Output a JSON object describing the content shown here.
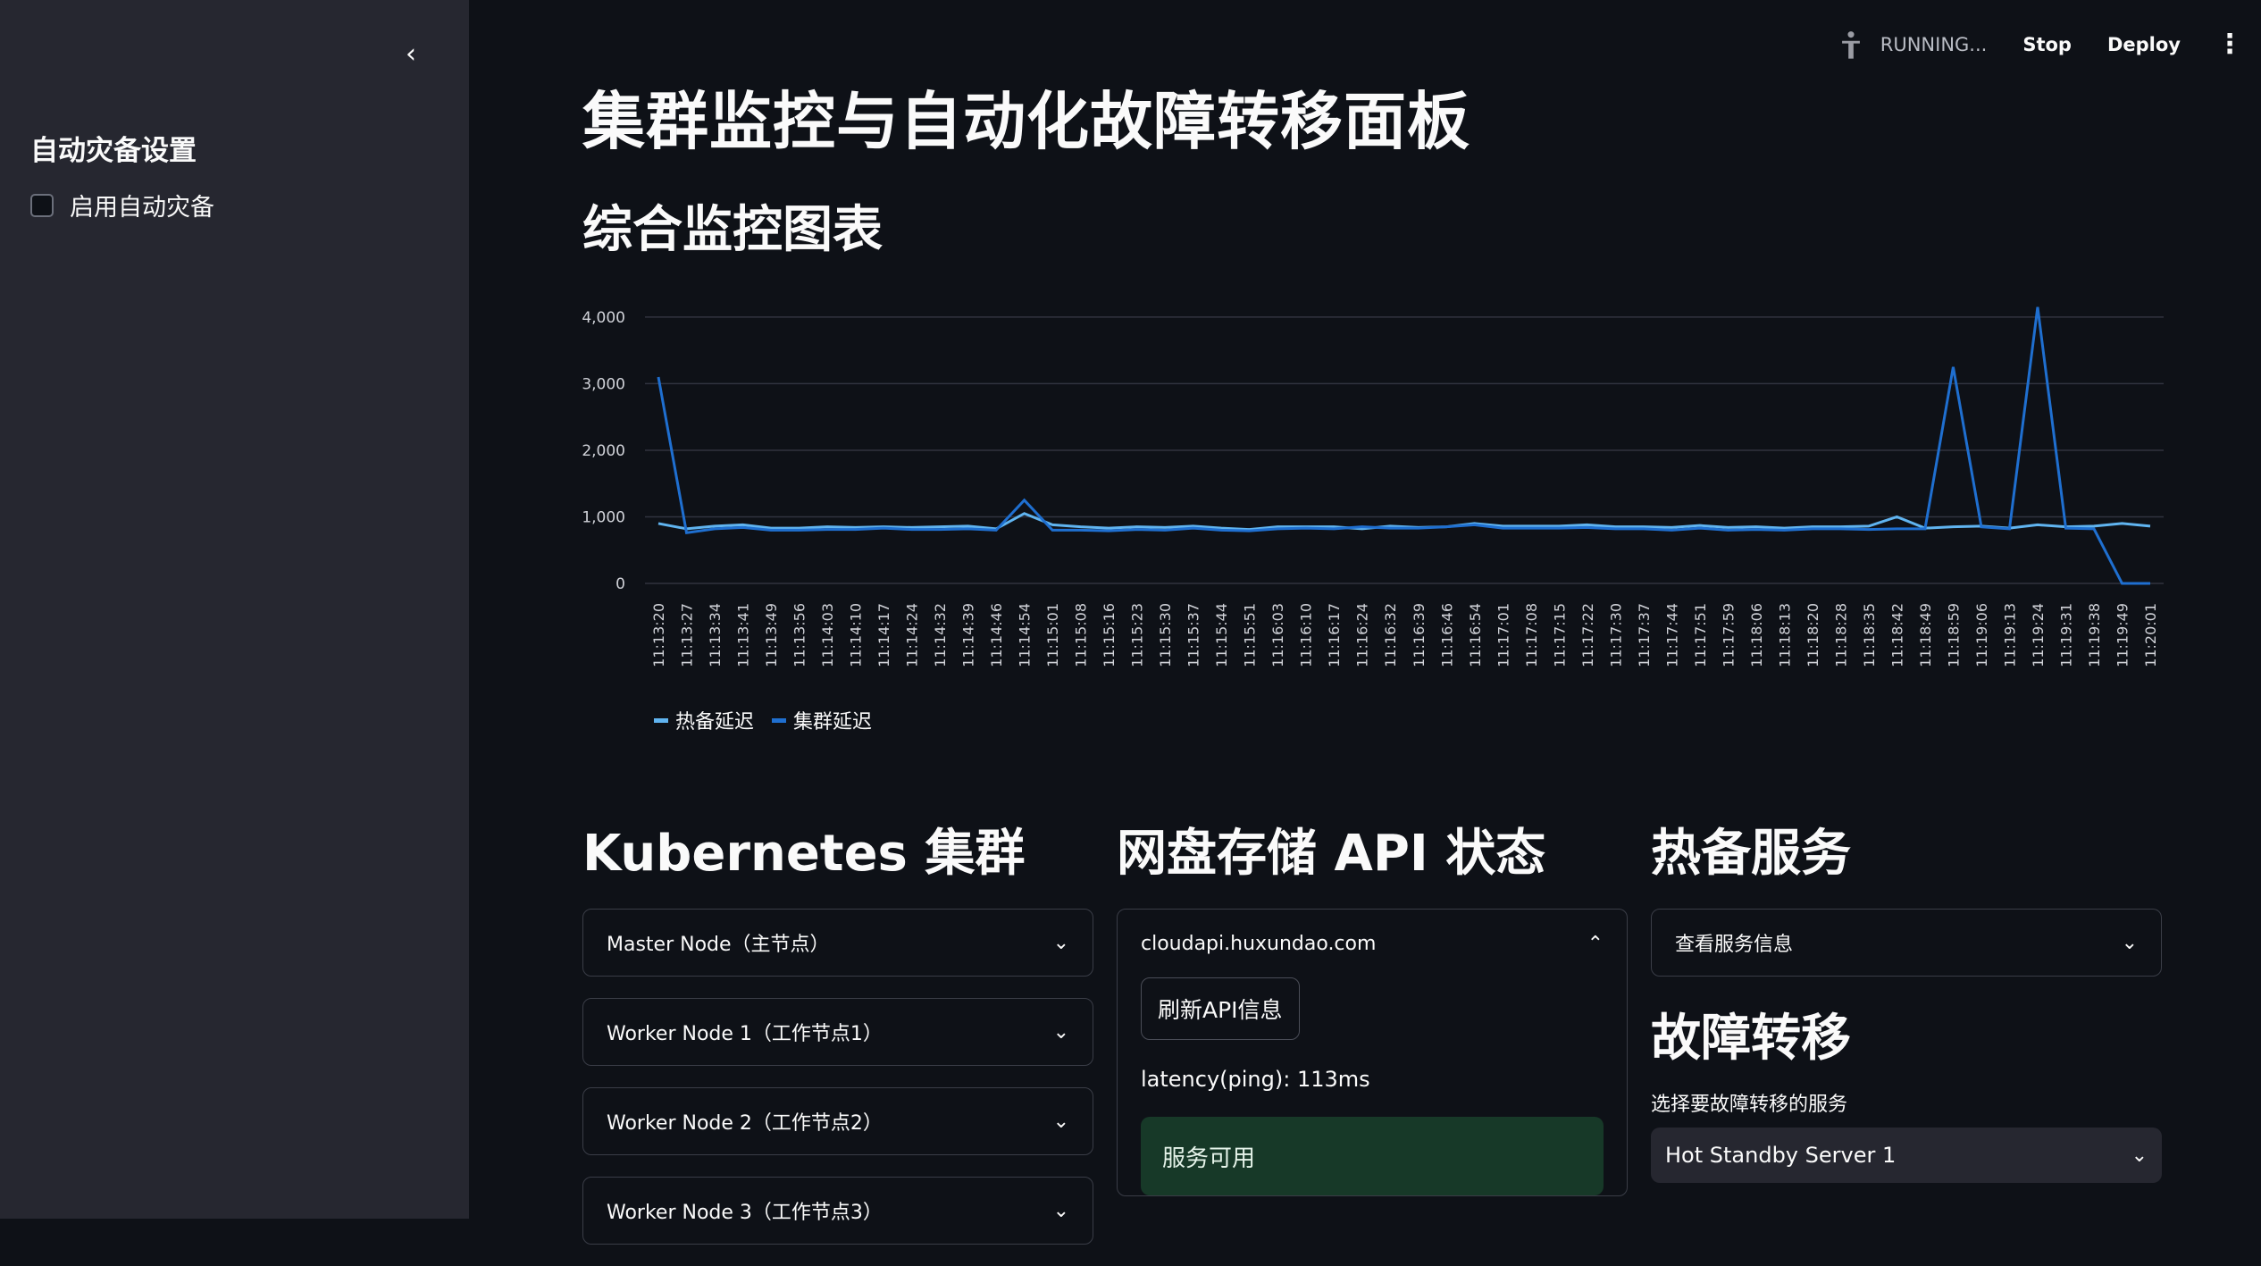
{
  "sidebar": {
    "collapse_icon": "chevron-left-icon",
    "heading": "自动灾备设置",
    "checkbox_label": "启用自动灾备",
    "checkbox_checked": false
  },
  "topbar": {
    "status": "RUNNING...",
    "stop": "Stop",
    "deploy": "Deploy"
  },
  "page": {
    "title": "集群监控与自动化故障转移面板",
    "chart_heading": "综合监控图表"
  },
  "chart_data": {
    "type": "line",
    "x": [
      "11:13:20",
      "11:13:27",
      "11:13:34",
      "11:13:41",
      "11:13:49",
      "11:13:56",
      "11:14:03",
      "11:14:10",
      "11:14:17",
      "11:14:24",
      "11:14:32",
      "11:14:39",
      "11:14:46",
      "11:14:54",
      "11:15:01",
      "11:15:08",
      "11:15:16",
      "11:15:23",
      "11:15:30",
      "11:15:37",
      "11:15:44",
      "11:15:51",
      "11:16:03",
      "11:16:10",
      "11:16:17",
      "11:16:24",
      "11:16:32",
      "11:16:39",
      "11:16:46",
      "11:16:54",
      "11:17:01",
      "11:17:08",
      "11:17:15",
      "11:17:22",
      "11:17:30",
      "11:17:37",
      "11:17:44",
      "11:17:51",
      "11:17:59",
      "11:18:06",
      "11:18:13",
      "11:18:20",
      "11:18:28",
      "11:18:35",
      "11:18:42",
      "11:18:49",
      "11:18:59",
      "11:19:06",
      "11:19:13",
      "11:19:24",
      "11:19:31",
      "11:19:38",
      "11:19:49",
      "11:20:01"
    ],
    "yticks": [
      0,
      1000,
      2000,
      3000,
      4000
    ],
    "ytick_labels": [
      "0",
      "1,000",
      "2,000",
      "3,000",
      "4,000"
    ],
    "ylim": [
      0,
      4200
    ],
    "series": [
      {
        "name": "热备延迟",
        "color": "#60b4f0",
        "values": [
          900,
          820,
          860,
          880,
          830,
          830,
          850,
          840,
          850,
          840,
          850,
          860,
          820,
          1050,
          880,
          850,
          830,
          850,
          840,
          860,
          830,
          810,
          850,
          850,
          850,
          820,
          860,
          840,
          850,
          900,
          860,
          860,
          860,
          880,
          850,
          850,
          840,
          870,
          840,
          850,
          830,
          850,
          850,
          860,
          1000,
          830,
          850,
          860,
          830,
          880,
          850,
          860,
          900,
          860
        ]
      },
      {
        "name": "集群延迟",
        "color": "#1f6fd0",
        "values": [
          3100,
          760,
          820,
          840,
          800,
          800,
          810,
          810,
          830,
          810,
          810,
          820,
          800,
          1250,
          800,
          800,
          790,
          810,
          800,
          830,
          800,
          790,
          820,
          830,
          820,
          850,
          830,
          830,
          850,
          880,
          830,
          830,
          830,
          840,
          820,
          820,
          800,
          830,
          800,
          810,
          800,
          820,
          820,
          810,
          820,
          820,
          3250,
          850,
          820,
          4150,
          830,
          820,
          0,
          0
        ]
      }
    ]
  },
  "kubernetes": {
    "heading": "Kubernetes 集群",
    "nodes": [
      "Master Node（主节点）",
      "Worker Node 1（工作节点1）",
      "Worker Node 2（工作节点2）",
      "Worker Node 3（工作节点3）"
    ]
  },
  "storage": {
    "heading": "网盘存储 API 状态",
    "host": "cloudapi.huxundao.com",
    "refresh_button": "刷新API信息",
    "latency": "latency(ping): 113ms",
    "status": "服务可用"
  },
  "standby": {
    "heading": "热备服务",
    "expander": "查看服务信息",
    "failover_heading": "故障转移",
    "select_label": "选择要故障转移的服务",
    "selected": "Hot Standby Server 1"
  }
}
